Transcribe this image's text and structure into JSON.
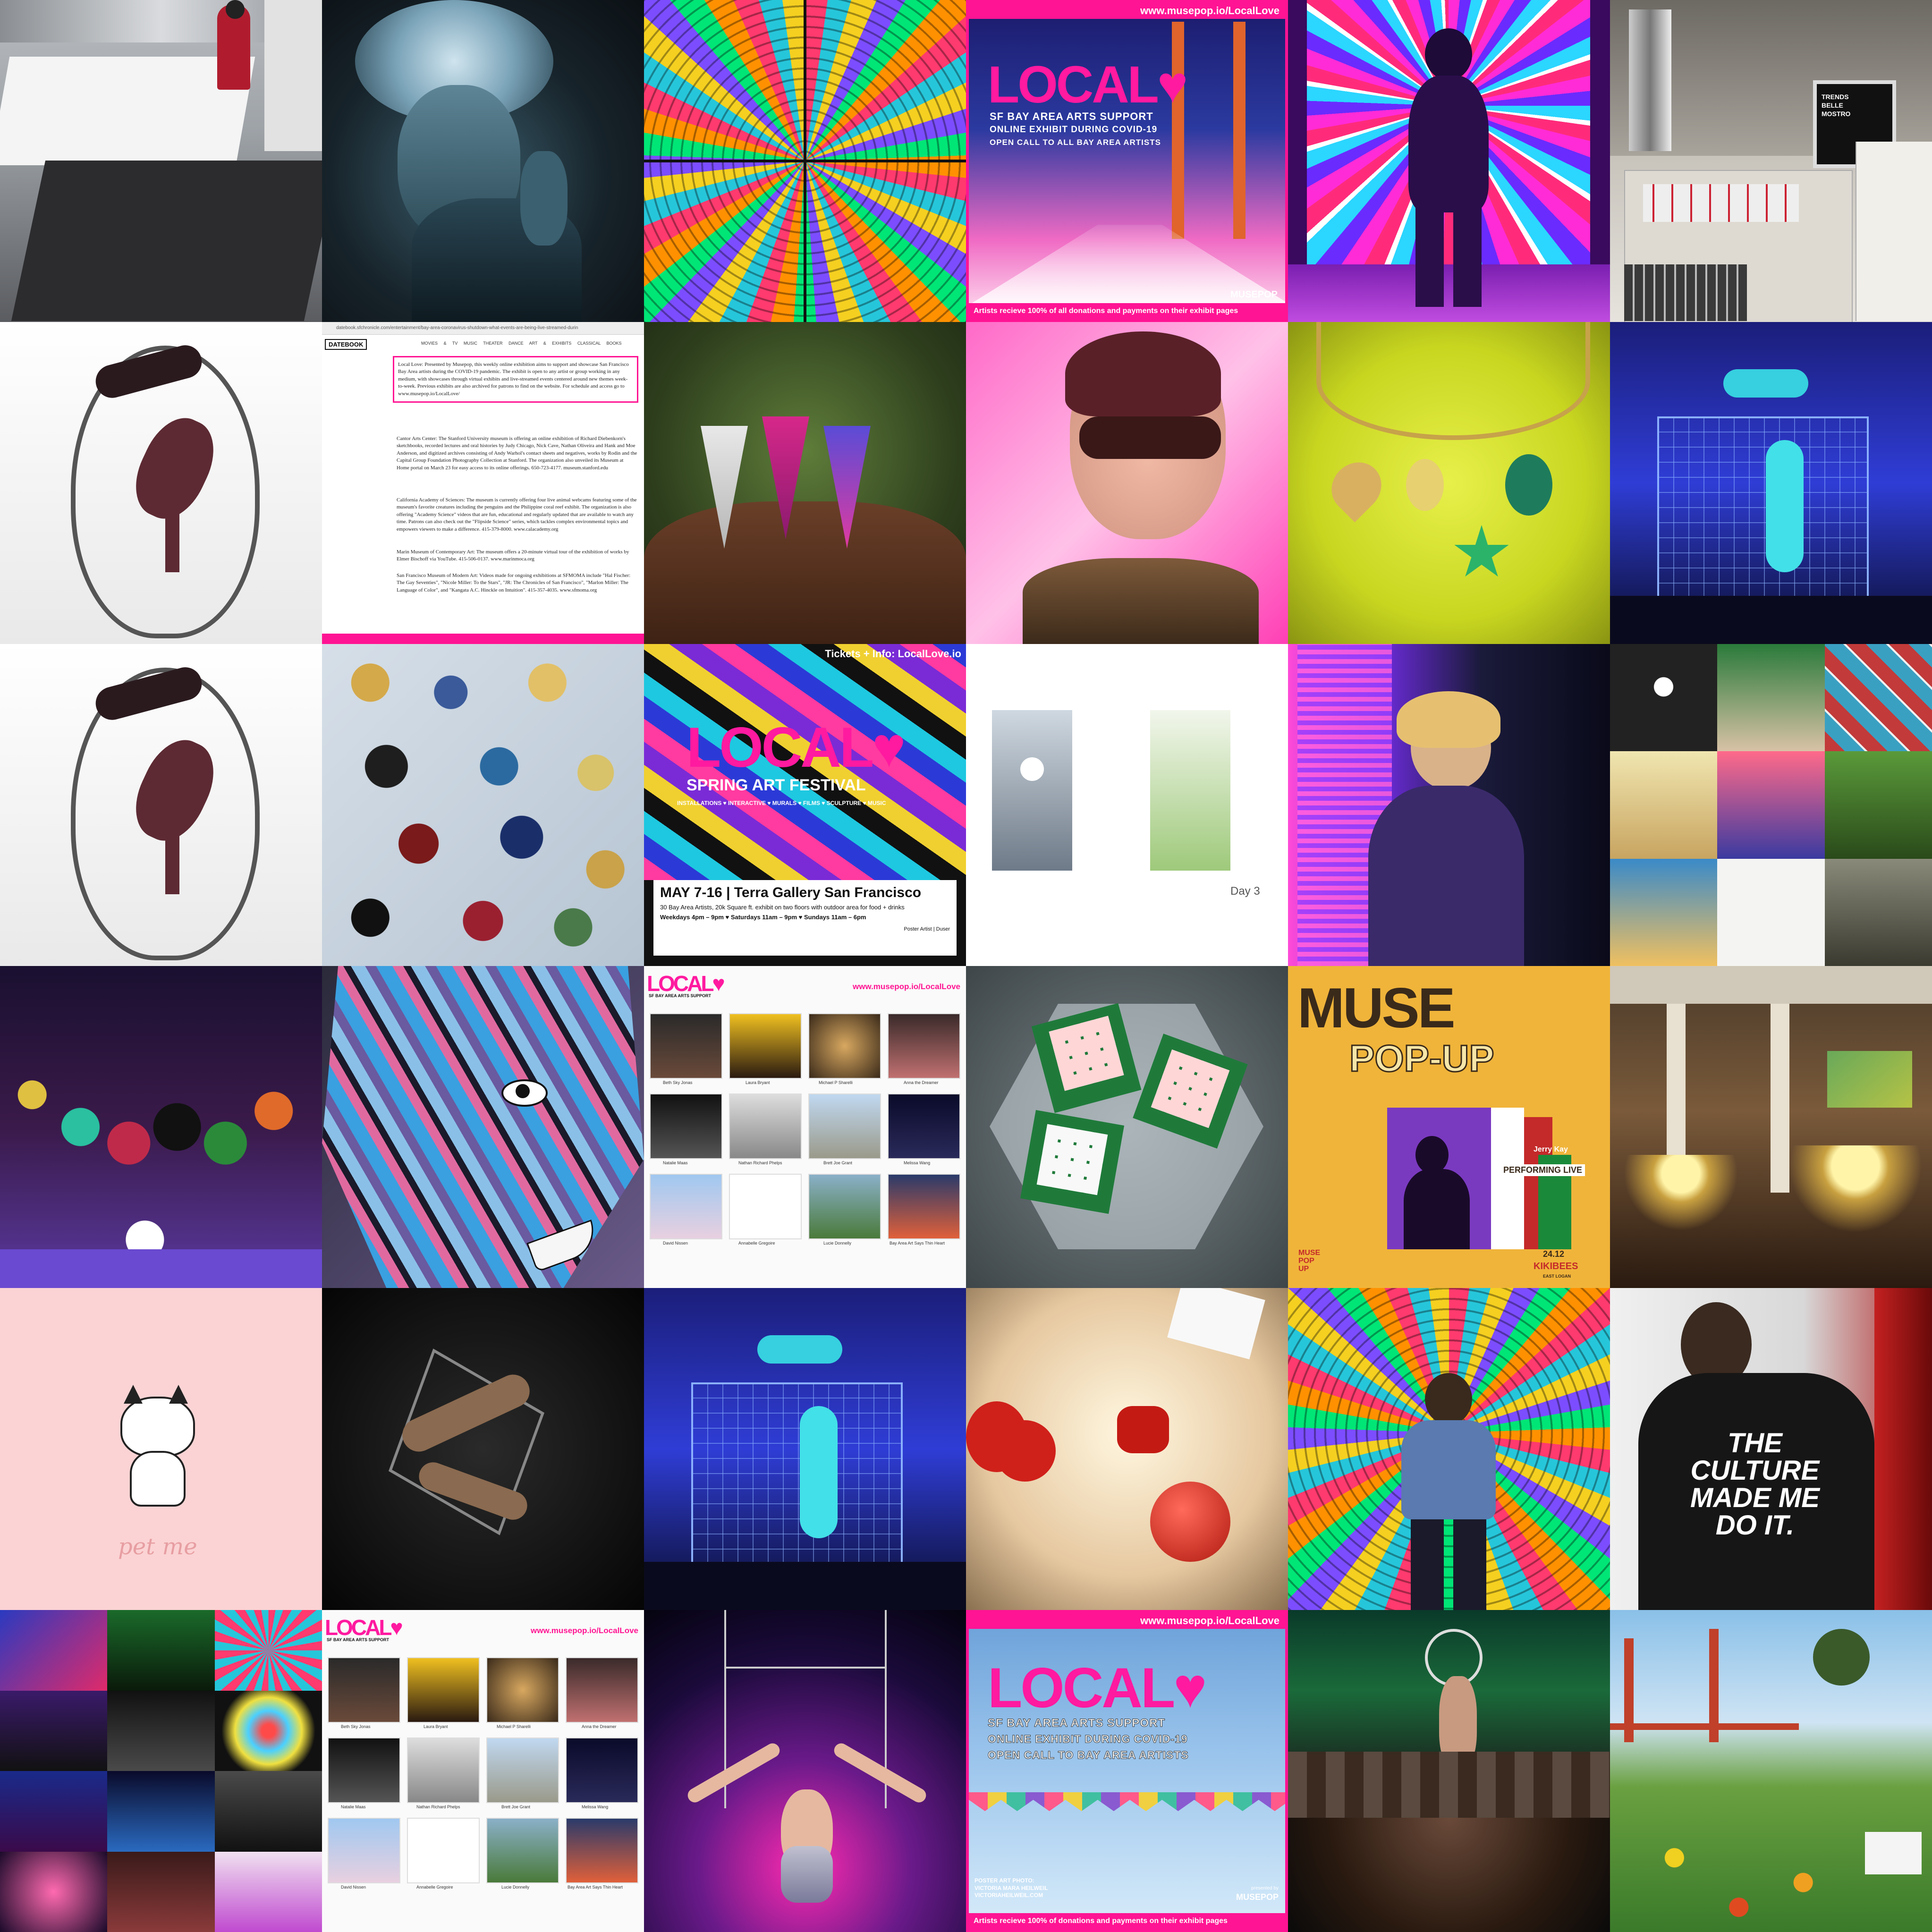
{
  "colors": {
    "brand_pink": "#ff1493",
    "poster_yellow": "#f0b43a",
    "bg_pink_soft": "#fbd3d4"
  },
  "local_poster": {
    "url": "www.musepop.io/LocalLove",
    "logo": "LOCAL",
    "heart_icon": "heart-icon",
    "line1": "SF BAY AREA ARTS SUPPORT",
    "line2": "ONLINE EXHIBIT DURING COVID-19",
    "line3": "OPEN CALL TO ALL BAY AREA ARTISTS",
    "footer": "Artists recieve 100% of all donations and payments on their exhibit pages",
    "brand": "MUSEPOP"
  },
  "local_poster_sky": {
    "url": "www.musepop.io/LocalLove",
    "logo": "LOCAL",
    "line1": "SF BAY AREA ARTS SUPPORT",
    "line2": "ONLINE EXHIBIT DURING COVID-19",
    "line3": "OPEN CALL TO BAY AREA ARTISTS",
    "credit1": "POSTER ART PHOTO:",
    "credit2": "VICTORIA MARA HEILWEIL",
    "credit3": "VICTORIAHEILWEIL.COM",
    "presented": "presented by",
    "brand": "MUSEPOP",
    "footer": "Artists recieve 100% of donations and payments on their exhibit pages"
  },
  "datebook": {
    "address": "datebook.sfchronicle.com/entertainment/bay-area-coronavirus-shutdown-what-events-are-being-live-streamed-durin",
    "logo": "DATEBOOK",
    "nav": [
      "MOVIES & TV",
      "MUSIC",
      "THEATER",
      "DANCE",
      "ART & EXHIBITS",
      "CLASSICAL",
      "BOOKS"
    ],
    "paragraphs": [
      "Local Love: Presented by Musepop, this weekly online exhibition aims to support and showcase San Francisco Bay Area artists during the COVID-19 pandemic. The exhibit is open to any artist or group working in any medium, with showcases through virtual exhibits and live-streamed events centered around new themes week-to-week. Previous exhibits are also archived for patrons to find on the website. For schedule and access go to www.musepop.io/LocalLove/",
      "Cantor Arts Center: The Stanford University museum is offering an online exhibition of Richard Diebenkorn's sketchbooks, recorded lectures and oral histories by Judy Chicago, Nick Cave, Nathan Oliveira and Hank and Moe Anderson, and digitized archives consisting of Andy Warhol's contact sheets and negatives, works by Rodin and the Capital Group Foundation Photography Collection at Stanford. The organization also unveiled its Museum at Home portal on March 23 for easy access to its online offerings. 650-723-4177. museum.stanford.edu",
      "California Academy of Sciences: The museum is currently offering four live animal webcams featuring some of the museum's favorite creatures including the penguins and the Philippine coral reef exhibit. The organization is also offering \"Academy Science\" videos that are fun, educational and regularly updated that are available to watch any time. Patrons can also check out the \"Flipside Science\" series, which tackles complex environmental topics and empowers viewers to make a difference. 415-379-8000. www.calacademy.org",
      "Marin Museum of Contemporary Art: The museum offers a 20-minute virtual tour of the exhibition of works by Elmer Bischoff via YouTube. 415-506-0137. www.marinmoca.org",
      "San Francisco Museum of Modern Art: Videos made for ongoing exhibitions at SFMOMA include \"Hal Fischer: The Gay Seventies\", \"Nicole Miller: To the Stars\", \"JR: The Chronicles of San Francisco\", \"Marlon Miller: The Language of Color\", and \"Kangata A.C. Hinckle on Intuition\". 415-357-4035. www.sfmoma.org"
    ]
  },
  "spring_festival": {
    "tickets": "Tickets + Info: LocalLove.io",
    "logo": "LOCAL",
    "title": "SPRING ART FESTIVAL",
    "categories": "INSTALLATIONS ♥ INTERACTIVE ♥ MURALS ♥ FILMS ♥ SCULPTURE ♥ MUSIC",
    "date_venue": "MAY 7-16 | Terra Gallery San Francisco",
    "details": "30 Bay Area Artists, 20k Square ft. exhibit on two floors with outdoor area for food + drinks",
    "hours": "Weekdays 4pm – 9pm ♥ Saturdays 11am – 9pm ♥ Sundays 11am – 6pm",
    "credit_left": "Poster Artist",
    "credit_right": "Duser"
  },
  "day3": {
    "label": "Day 3"
  },
  "pet_me": {
    "caption": "pet me"
  },
  "muse_popup": {
    "title": "MUSE",
    "subtitle": "POP-UP",
    "artist": "Jerry Kay",
    "performing": "PERFORMING LIVE",
    "date": "24.12",
    "venue": "KIKIBEES",
    "venue_sub": "EAST LOGAN",
    "logo_top": "MUSE",
    "logo_mid": "POP",
    "logo_bot": "UP"
  },
  "gallery_page": {
    "logo": "LOCAL",
    "subtitle": "SF BAY AREA ARTS SUPPORT",
    "url": "www.musepop.io/LocalLove",
    "artists": [
      "Beth Sky Jonas",
      "Laura Bryant",
      "Michael P Sharelli",
      "Anna the Dreamer",
      "Natalie Maas",
      "Nathan Richard Phelps",
      "Brett Joe Grant",
      "Melissa Wang",
      "David Nissen",
      "Annabelle Gregoire",
      "Lucie Donnelly",
      "Bay Area Art Says Thin Heart"
    ]
  },
  "tshirt": {
    "line1": "THE",
    "line2": "CULTURE",
    "line3": "MADE ME",
    "line4": "DO IT."
  },
  "monitor": {
    "line1": "TRENDS",
    "line2": "BELLE",
    "line3": "MOSTRO"
  }
}
